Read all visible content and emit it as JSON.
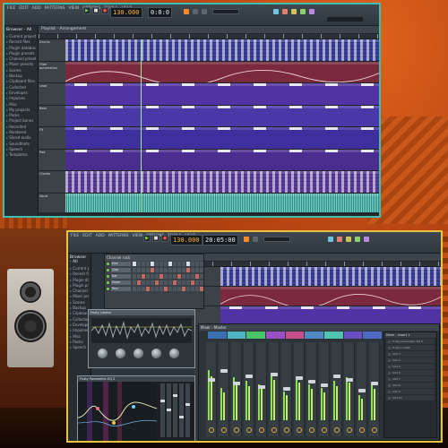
{
  "window1": {
    "menu": [
      "FILE",
      "EDIT",
      "ADD",
      "PATTERNS",
      "VIEW",
      "OPTIONS",
      "TOOLS",
      "HELP"
    ],
    "time_display": "0:0:0",
    "tempo": "130.000",
    "browser": {
      "title": "Browser - All",
      "items": [
        "Current project",
        "Recent files",
        "Plugin database",
        "Plugin presets",
        "Channel presets",
        "Mixer presets",
        "Scores",
        "Backup",
        "Clipboard files",
        "Collected",
        "Envelopes",
        "Impulses",
        "Misc",
        "My projects",
        "Packs",
        "Project bones",
        "Recorded",
        "Rendered",
        "Sliced audio",
        "Soundfonts",
        "Speech",
        "Templates"
      ]
    },
    "playlist": {
      "title": "Playlist - Arrangement",
      "tracks": [
        {
          "label": "Drums",
          "color": "#3a3f9a",
          "style": "pattern"
        },
        {
          "label": "Filter automation",
          "color": "#7a2a3c",
          "style": "automation"
        },
        {
          "label": "Lead",
          "color": "#5133a3",
          "style": "notes"
        },
        {
          "label": "Bass",
          "color": "#4a38a8",
          "style": "notes"
        },
        {
          "label": "FX",
          "color": "#3f2f9d",
          "style": "notes"
        },
        {
          "label": "Pad",
          "color": "#4a2d8e",
          "style": "notes"
        },
        {
          "label": "Chords",
          "color": "#5a3a9a",
          "style": "pattern"
        },
        {
          "label": "Vocal",
          "color": "#2a8a86",
          "style": "audio"
        }
      ]
    }
  },
  "window2": {
    "menu": [
      "FILE",
      "EDIT",
      "ADD",
      "PATTERNS",
      "VIEW",
      "OPTIONS",
      "TOOLS",
      "HELP"
    ],
    "time_display": "20:05:00",
    "tempo": "130.000",
    "browser": {
      "title": "Browser - All",
      "items": [
        "Current project",
        "Recent files",
        "Plugin database",
        "Plugin presets",
        "Channel presets",
        "Mixer presets",
        "Scores",
        "Backup",
        "Clipboard files",
        "Collected",
        "Envelopes",
        "Impulses",
        "Misc",
        "Packs",
        "Speech"
      ]
    },
    "channel_rack": {
      "title": "Channel rack",
      "channels": [
        "Kick",
        "Clap",
        "Hat",
        "Snare",
        "Perc"
      ]
    },
    "plugin_compressor": {
      "title": "Fruity Limiter"
    },
    "plugin_eq": {
      "title": "Fruity Parametric EQ 2"
    },
    "mixer": {
      "title": "Mixer - Master",
      "insert_colors": [
        "#3b6fb0",
        "#4fb3c4",
        "#47c46a",
        "#9a4fc4",
        "#c44f8c",
        "#4f8ac4",
        "#4fc4b3",
        "#6a4fc4",
        "#4f6ac4"
      ],
      "side_title": "Mixer - Insert 1",
      "slots": [
        "Fruity parametric EQ 2",
        "Fruity Limiter",
        "Slot 3",
        "Slot 4",
        "Slot 5",
        "Slot 6",
        "Slot 7",
        "Slot 8",
        "Slot 9",
        "Slot 10"
      ]
    }
  },
  "colors": {
    "window1_border": "#3fbfb0",
    "window2_border": "#e9c23f",
    "tempo_text": "#ffb13d"
  }
}
